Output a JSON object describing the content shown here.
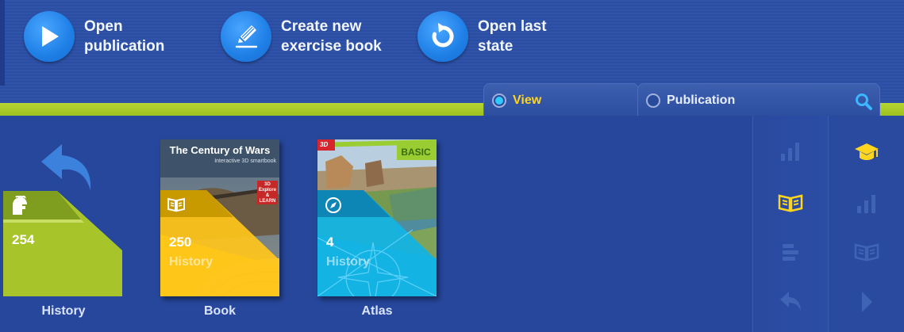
{
  "actions": [
    {
      "label": "Open publication"
    },
    {
      "label": "Create new exercise book"
    },
    {
      "label": "Open last state"
    }
  ],
  "tabs": {
    "view_label": "View",
    "publication_label": "Publication"
  },
  "tiles": [
    {
      "name": "History",
      "count": "254",
      "subtitle": ""
    },
    {
      "name": "Book",
      "count": "250",
      "subtitle": "History",
      "cover_title": "The Century of Wars",
      "cover_subtitle": "Interactive 3D smartbook",
      "cover_badge_top": "3D",
      "cover_badge_line1": "Explore &",
      "cover_badge_line2": "LEARN"
    },
    {
      "name": "Atlas",
      "count": "4",
      "subtitle": "History",
      "cover_tag": "BASIC",
      "corner_logo": "3D"
    }
  ],
  "colors": {
    "accent_yellow": "#ffd51f",
    "lime": "#a8c92a",
    "blue_dark": "#25459b",
    "book_yellow": "#ffc61a",
    "atlas_cyan": "#13b3e3"
  },
  "sidebar": {
    "left_icons": [
      "bar-chart-icon",
      "open-book-icon",
      "list-icon",
      "undo-arrow-icon"
    ],
    "right_icons": [
      "graduation-cap-icon",
      "bar-chart-icon",
      "open-book-icon",
      "play-right-icon"
    ]
  }
}
